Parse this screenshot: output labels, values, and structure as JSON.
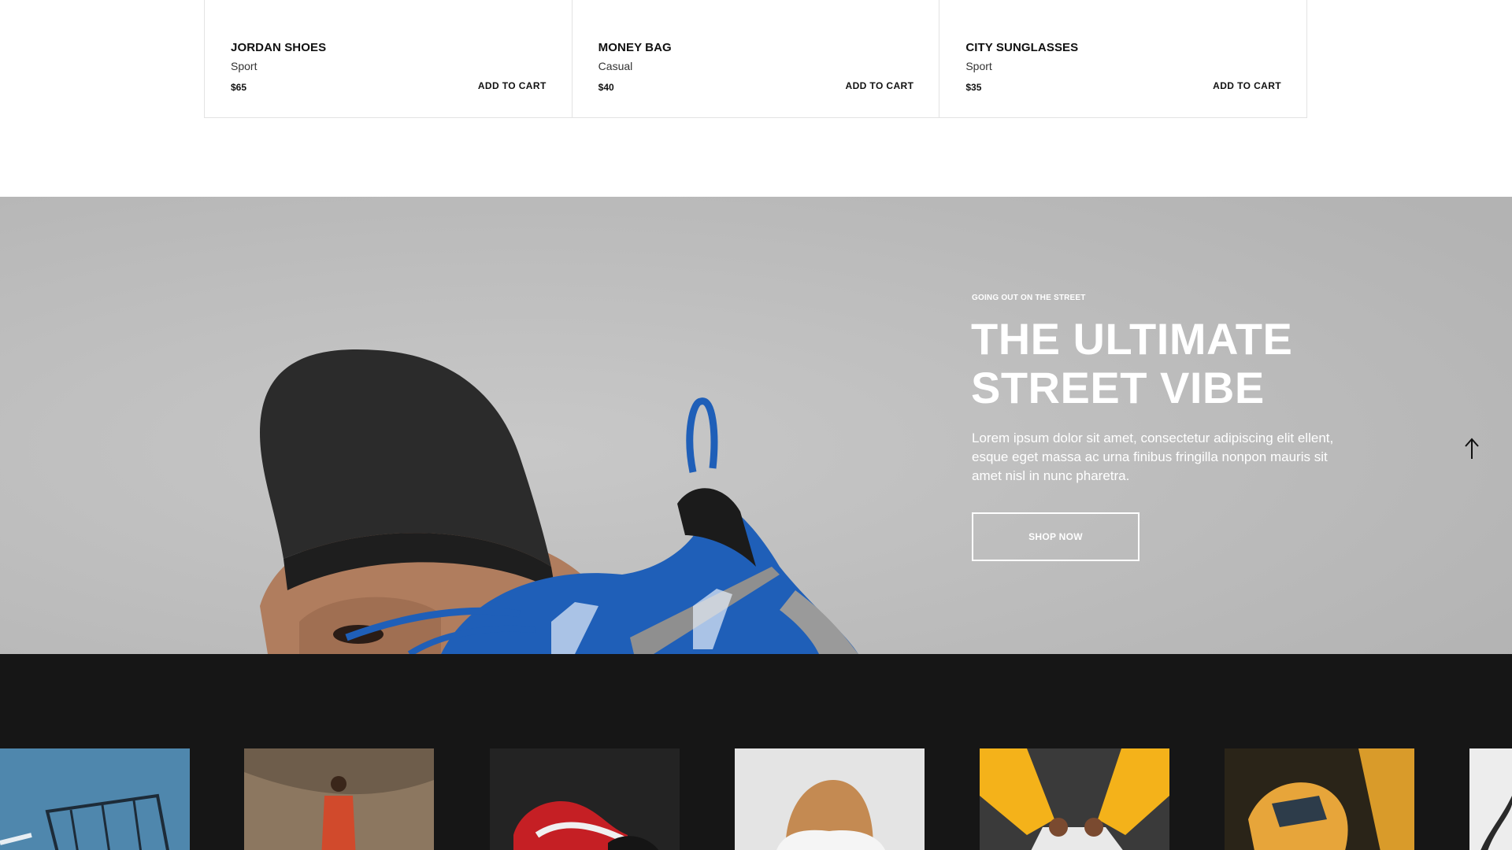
{
  "products": [
    {
      "name": "JORDAN SHOES",
      "category": "Sport",
      "price": "$65",
      "cta": "ADD TO CART"
    },
    {
      "name": "MONEY BAG",
      "category": "Casual",
      "price": "$40",
      "cta": "ADD TO CART"
    },
    {
      "name": "CITY SUNGLASSES",
      "category": "Sport",
      "price": "$35",
      "cta": "ADD TO CART"
    }
  ],
  "hero": {
    "eyebrow": "GOING OUT ON THE STREET",
    "title_line1": "THE ULTIMATE",
    "title_line2": "STREET VIBE",
    "text": "Lorem ipsum dolor sit amet, consectetur adipiscing elit ellent, esque eget massa ac urna finibus fringilla nonpon mauris sit amet nisl in nunc pharetra.",
    "button": "SHOP NOW"
  },
  "icons": {
    "back_to_top": "arrow-up-icon"
  },
  "colors": {
    "hero_bg": "#bdbdbd",
    "gallery_bg": "#161616",
    "accent_blue": "#1f5fb8"
  }
}
